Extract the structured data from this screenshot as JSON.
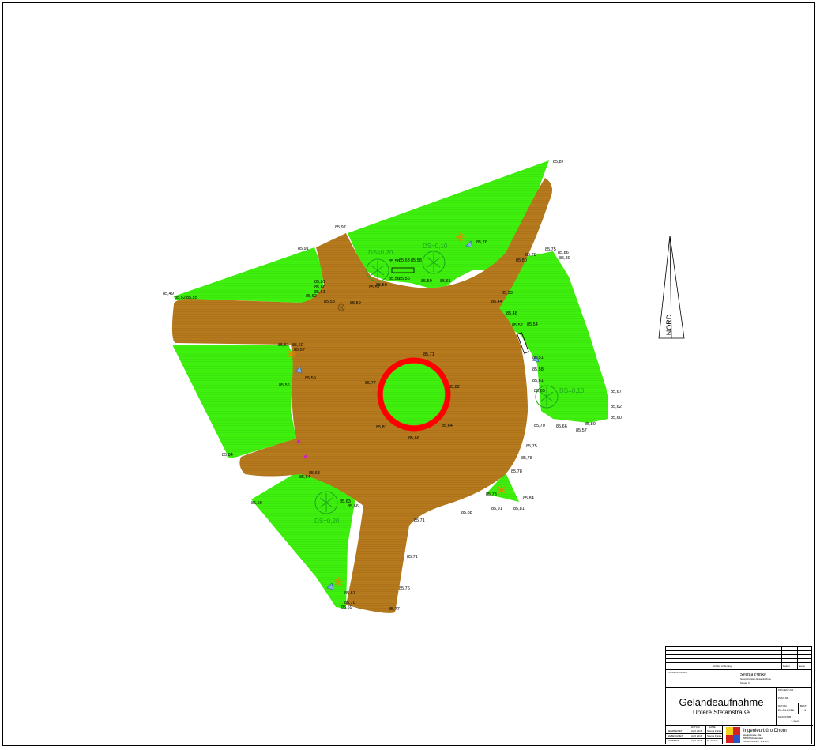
{
  "plan": {
    "tree_labels": [
      "DS=0,20",
      "DS=0,10",
      "DS=0,10",
      "DS=0,20"
    ],
    "elevation_labels": [
      "85,87",
      "85,76",
      "85,97",
      "85,91",
      "85,81",
      "85,60",
      "85,61",
      "85,62",
      "85,49",
      "85,52",
      "85,55",
      "85,58",
      "85,59",
      "85,59",
      "85,56",
      "85,57",
      "85,56",
      "85,56",
      "85,59",
      "85,61",
      "85,63",
      "85,58",
      "85,80",
      "85,78",
      "85,75",
      "85,86",
      "85,89",
      "85,53",
      "85,44",
      "85,48",
      "85,52",
      "85,54",
      "85,51",
      "85,58",
      "85,61",
      "85,65",
      "85,67",
      "85,62",
      "85,60",
      "85,80",
      "85,57",
      "85,66",
      "85,70",
      "85,75",
      "85,78",
      "85,78",
      "85,73",
      "85,91",
      "85,84",
      "85,81",
      "85,88",
      "85,61",
      "85,60",
      "85,57",
      "85,59",
      "85,56",
      "85,71",
      "85,77",
      "85,82",
      "85,81",
      "85,64",
      "85,66",
      "85,84",
      "85,64",
      "85,63",
      "85,69",
      "85,63",
      "85,66",
      "85,71",
      "85,71",
      "85,76",
      "85,77",
      "85,67",
      "85,70",
      "85,69"
    ]
  },
  "north_arrow": {
    "label": "NORD"
  },
  "title_block": {
    "header_a": "Art der Änderung",
    "header_b": "Datum",
    "header_c": "Name",
    "auftraggeber_label": "AUFTRAGGEBER",
    "client_name": "Svenja Funke",
    "client_school": "Georg-Forster-Gesamtschule",
    "client_class": "Klasse 7c",
    "project_label": "PROJEKT-NR.",
    "plan_no_label": "PLAN-NR.",
    "title": "Geländeaufnahme",
    "subtitle": "Untere Stefanstraße",
    "date_label": "DATUM",
    "date_value": "26.04.2016",
    "sheet_label": "BLATT",
    "sheet_value": "1",
    "scale_label": "MASSSTAB",
    "scale_value": "1:500",
    "rows": [
      {
        "role": "BEARBEITET",
        "date": "April 2016",
        "name": "Svenja Funke"
      },
      {
        "role": "GEZEICHNET",
        "date": "April 2016",
        "name": "Svenja Funke"
      },
      {
        "role": "GEPRÜFT",
        "date": "April 2016",
        "name": "Dr. Frehse"
      }
    ],
    "row_head_date": "DATUM",
    "row_head_name": "NAME",
    "office_name": "Ingenieurbüro Dhom",
    "office_line1": "Hauptstraße 10a",
    "office_line2": "55597 Musterstadt",
    "office_line3": "Telefon 06136 / 123 45 6"
  },
  "colors": {
    "road": "#b5791e",
    "green": "#3ff00f",
    "ring": "#ff0000",
    "ring_center": "#3ff00f"
  }
}
